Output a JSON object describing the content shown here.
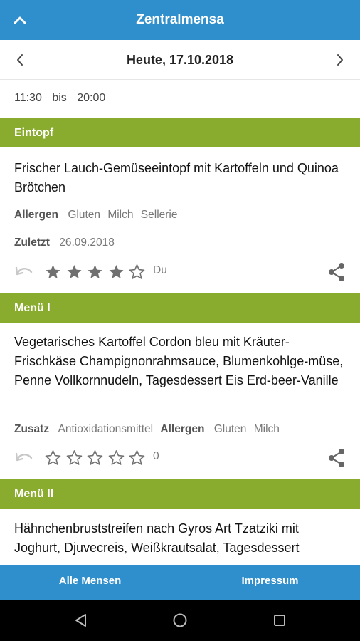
{
  "app_bar": {
    "title": "Zentralmensa",
    "up_icon": "chevron-up-icon"
  },
  "date_nav": {
    "date": "Heute, 17.10.2018",
    "prev_icon": "chevron-left-icon",
    "next_icon": "chevron-right-icon"
  },
  "hours": {
    "from": "11:30",
    "separator": "bis",
    "to": "20:00"
  },
  "sections": [
    {
      "header": "Eintopf",
      "meal": {
        "name": "Frischer Lauch-Gemüseeintopf mit Kartoffeln und Quinoa Brötchen",
        "allergens_label": "Allergen",
        "allergens": [
          "Gluten",
          "Milch",
          "Sellerie"
        ],
        "last_label": "Zuletzt",
        "last_date": "26.09.2018",
        "rating": 4,
        "rating_max": 5,
        "rating_text": "Du"
      }
    },
    {
      "header": "Menü I",
      "meal": {
        "name": "Vegetarisches Kartoffel Cordon bleu mit Kräuter-Frischkäse Champignonrahmsauce, Blumenkohlge-müse, Penne Vollkornnudeln, Tagesdessert Eis Erd-beer-Vanille",
        "additives_label": "Zusatz",
        "additives": [
          "Antioxidationsmittel"
        ],
        "allergens_label": "Allergen",
        "allergens": [
          "Gluten",
          "Milch"
        ],
        "rating": 0,
        "rating_max": 5,
        "rating_text": "0"
      }
    },
    {
      "header": "Menü II",
      "meal": {
        "name": "Hähnchenbruststreifen nach Gyros Art Tzatziki mit Joghurt, Djuvecreis, Weißkrautsalat, Tagesdessert"
      }
    }
  ],
  "bottom_nav": {
    "all_canteens": "Alle Mensen",
    "imprint": "Impressum"
  },
  "colors": {
    "primary": "#2f8fcc",
    "section": "#8aac2e",
    "star": "#707070"
  }
}
